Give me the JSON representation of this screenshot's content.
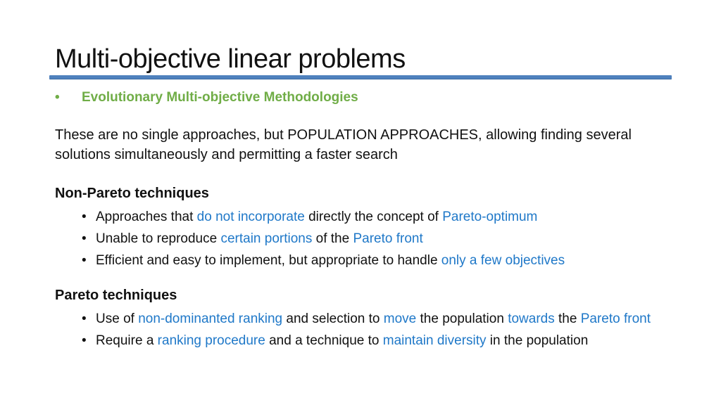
{
  "slide": {
    "title": "Multi-objective linear problems",
    "subheading": {
      "bullet": "•",
      "text": "Evolutionary Multi-objective Methodologies",
      "color": "#70ad47"
    },
    "intro": "These are no single approaches, but POPULATION APPROACHES, allowing finding several solutions simultaneously and permitting a faster search",
    "highlight_color": "#1f78c8",
    "accent_rule_color": "#4f81bd",
    "sections": [
      {
        "title": "Non-Pareto techniques",
        "items": [
          [
            {
              "t": "Approaches that ",
              "h": false
            },
            {
              "t": "do not incorporate",
              "h": true
            },
            {
              "t": " directly the concept of ",
              "h": false
            },
            {
              "t": "Pareto-optimum",
              "h": true
            }
          ],
          [
            {
              "t": "Unable to reproduce ",
              "h": false
            },
            {
              "t": "certain portions",
              "h": true
            },
            {
              "t": " of the ",
              "h": false
            },
            {
              "t": "Pareto front",
              "h": true
            }
          ],
          [
            {
              "t": "Efficient and easy to implement, but appropriate to handle ",
              "h": false
            },
            {
              "t": "only a few objectives",
              "h": true
            }
          ]
        ]
      },
      {
        "title": "Pareto techniques",
        "items": [
          [
            {
              "t": "Use of ",
              "h": false
            },
            {
              "t": "non-dominanted ranking",
              "h": true
            },
            {
              "t": " and selection to ",
              "h": false
            },
            {
              "t": "move",
              "h": true
            },
            {
              "t": " the population ",
              "h": false
            },
            {
              "t": "towards",
              "h": true
            },
            {
              "t": " the ",
              "h": false
            },
            {
              "t": "Pareto front",
              "h": true
            }
          ],
          [
            {
              "t": "Require a ",
              "h": false
            },
            {
              "t": "ranking procedure",
              "h": true
            },
            {
              "t": " and a technique to ",
              "h": false
            },
            {
              "t": "maintain diversity",
              "h": true
            },
            {
              "t": " in the population",
              "h": false
            }
          ]
        ]
      }
    ]
  }
}
